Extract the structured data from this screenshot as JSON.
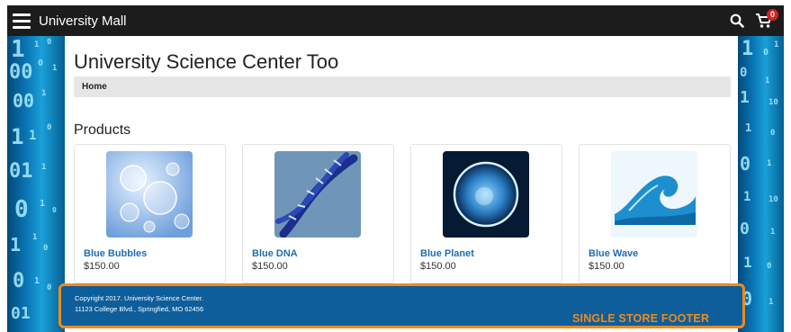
{
  "header": {
    "site_title": "University Mall",
    "menu_icon": "hamburger-menu-icon",
    "search_icon": "search-icon",
    "cart_icon": "cart-icon",
    "cart_count": "0"
  },
  "page": {
    "title": "University Science Center Too",
    "breadcrumb": "Home",
    "section_title": "Products"
  },
  "products": [
    {
      "name": "Blue Bubbles",
      "price": "$150.00"
    },
    {
      "name": "Blue DNA",
      "price": "$150.00"
    },
    {
      "name": "Blue Planet",
      "price": "$150.00"
    },
    {
      "name": "Blue Wave",
      "price": "$150.00"
    }
  ],
  "footer": {
    "line1": "Copyright 2017. University Science Center.",
    "line2": "11123 College Blvd., Springfied, MO 62456",
    "callout": "SINGLE STORE FOOTER"
  },
  "colors": {
    "topbar": "#1c1c1c",
    "footer": "#0d5e9b",
    "highlight": "#f08a1c",
    "link": "#1c6eb5",
    "badge": "#d9201f"
  }
}
